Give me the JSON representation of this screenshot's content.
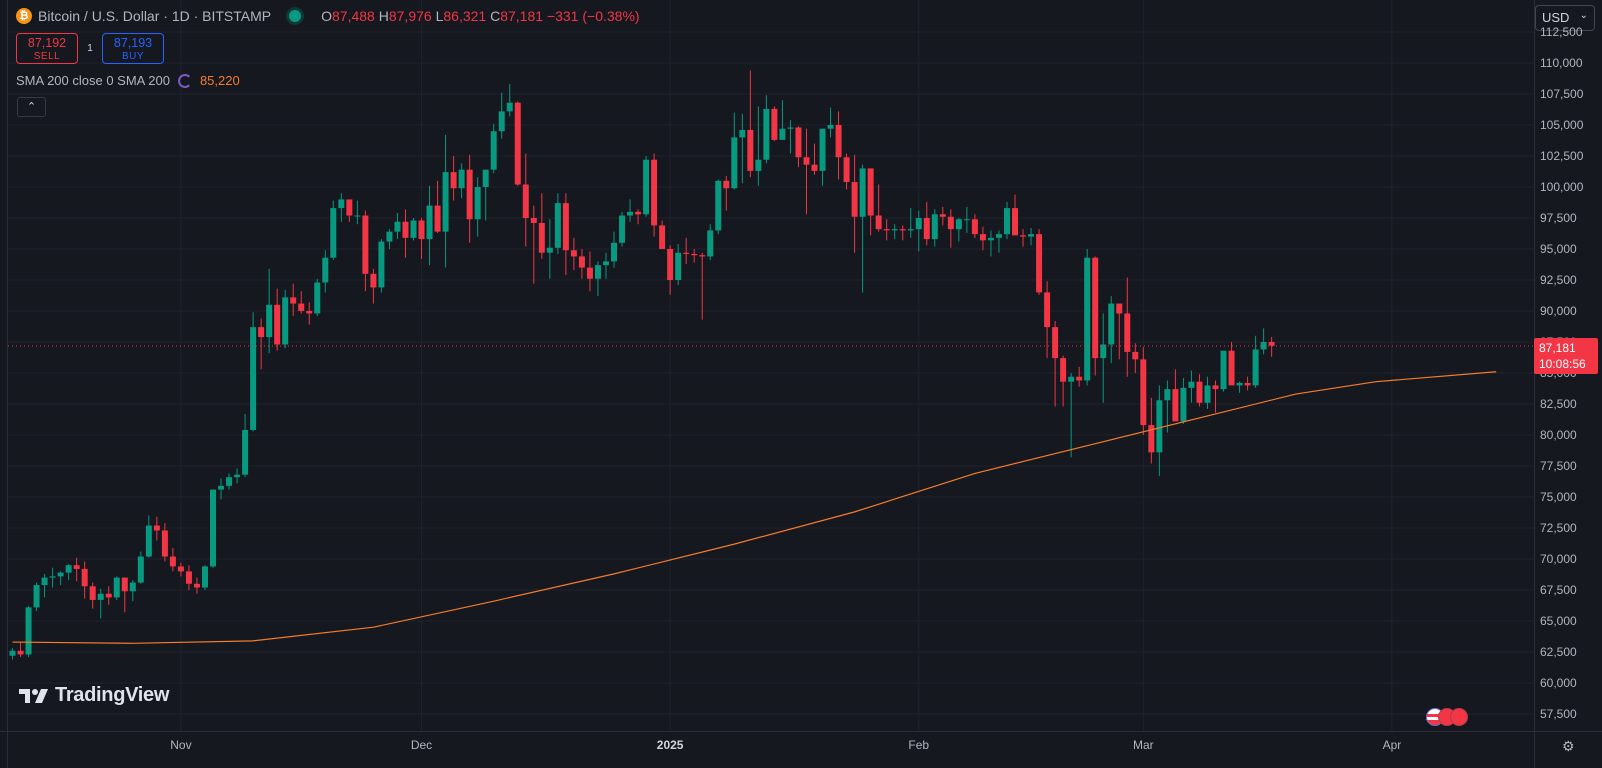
{
  "header": {
    "coin_symbol": "₿",
    "title": "Bitcoin / U.S. Dollar · 1D · BITSTAMP",
    "ohlc": {
      "o_label": "O",
      "o": "87,488",
      "h_label": "H",
      "h": "87,976",
      "l_label": "L",
      "l": "86,321",
      "c_label": "C",
      "c": "87,181",
      "change": "−331 (−0.38%)"
    }
  },
  "trade": {
    "sell_price": "87,192",
    "sell_label": "SELL",
    "spread": "1",
    "buy_price": "87,193",
    "buy_label": "BUY"
  },
  "indicator": {
    "label": "SMA 200 close 0 SMA 200",
    "value": "85,220"
  },
  "collapse_glyph": "⌃",
  "currency": {
    "label": "USD",
    "caret": "⌄"
  },
  "last_price": {
    "price": "87,181",
    "countdown": "10:08:56"
  },
  "brand": {
    "mark": "⁴⁷",
    "name": "TradingView"
  },
  "settings_glyph": "⚙",
  "colors": {
    "up": "#089981",
    "down": "#f23645",
    "sma": "#f57c2d",
    "grid": "#1e222d",
    "bg": "#15181e",
    "last_line": "#f23645"
  },
  "chart_data": {
    "type": "candlestick",
    "title": "Bitcoin / U.S. Dollar · 1D · BITSTAMP",
    "ylim": [
      57500,
      113000
    ],
    "y_ticks": [
      57500,
      60000,
      62500,
      65000,
      67500,
      70000,
      72500,
      75000,
      77500,
      80000,
      82500,
      85000,
      87500,
      90000,
      92500,
      95000,
      97500,
      100000,
      102500,
      105000,
      107500,
      110000,
      112500
    ],
    "y_tick_labels": [
      "57,500",
      "60,000",
      "62,500",
      "65,000",
      "67,500",
      "70,000",
      "72,500",
      "75,000",
      "77,500",
      "80,000",
      "82,500",
      "85,000",
      "87,500",
      "90,000",
      "92,500",
      "95,000",
      "97,500",
      "100,000",
      "102,500",
      "105,000",
      "107,500",
      "110,000",
      "112,500"
    ],
    "x_ticks": [
      {
        "label": "Nov",
        "day": "2024-11-01"
      },
      {
        "label": "Dec",
        "day": "2024-12-01"
      },
      {
        "label": "2025",
        "day": "2025-01-01",
        "bold": true
      },
      {
        "label": "Feb",
        "day": "2025-02-01"
      },
      {
        "label": "Mar",
        "day": "2025-03-01"
      },
      {
        "label": "Apr",
        "day": "2025-04-01"
      }
    ],
    "first_date": "2024-10-11",
    "candles": [
      [
        62200,
        62800,
        61900,
        62600
      ],
      [
        62600,
        63300,
        62100,
        62300
      ],
      [
        62300,
        66200,
        62100,
        66100
      ],
      [
        66100,
        68100,
        65800,
        67900
      ],
      [
        67900,
        68800,
        66900,
        68500
      ],
      [
        68500,
        69300,
        67700,
        68600
      ],
      [
        68600,
        69000,
        67900,
        68900
      ],
      [
        68900,
        69600,
        68300,
        69500
      ],
      [
        69500,
        70100,
        68200,
        69200
      ],
      [
        69200,
        69800,
        66800,
        67800
      ],
      [
        67800,
        68100,
        66000,
        66700
      ],
      [
        66700,
        67600,
        65200,
        67200
      ],
      [
        67200,
        67800,
        66300,
        66900
      ],
      [
        66900,
        68600,
        66700,
        68500
      ],
      [
        68500,
        68400,
        65700,
        67400
      ],
      [
        67400,
        68300,
        66600,
        68100
      ],
      [
        68100,
        70600,
        68000,
        70200
      ],
      [
        70200,
        73500,
        70100,
        72700
      ],
      [
        72700,
        73400,
        71500,
        72300
      ],
      [
        72300,
        72900,
        69800,
        70200
      ],
      [
        70200,
        70900,
        69000,
        69400
      ],
      [
        69400,
        69700,
        68600,
        69000
      ],
      [
        69000,
        69500,
        67500,
        68000
      ],
      [
        68000,
        68500,
        67200,
        67700
      ],
      [
        67700,
        69500,
        67500,
        69400
      ],
      [
        69400,
        75500,
        69300,
        75600
      ],
      [
        75600,
        76500,
        74800,
        75900
      ],
      [
        75900,
        76900,
        75600,
        76600
      ],
      [
        76600,
        77300,
        76100,
        76800
      ],
      [
        76800,
        81700,
        76600,
        80400
      ],
      [
        80400,
        89900,
        80300,
        88700
      ],
      [
        88700,
        89400,
        85300,
        87900
      ],
      [
        87900,
        93400,
        86600,
        90500
      ],
      [
        90500,
        91800,
        86800,
        87300
      ],
      [
        87300,
        91700,
        87000,
        91100
      ],
      [
        91100,
        92200,
        89600,
        90600
      ],
      [
        90600,
        91600,
        89800,
        90000
      ],
      [
        90000,
        90700,
        88900,
        89800
      ],
      [
        89800,
        92600,
        89600,
        92300
      ],
      [
        92300,
        94900,
        91500,
        94300
      ],
      [
        94300,
        98900,
        94100,
        98300
      ],
      [
        98300,
        99500,
        97200,
        99000
      ],
      [
        99000,
        99000,
        97200,
        97700
      ],
      [
        97700,
        98900,
        97000,
        97700
      ],
      [
        97700,
        98100,
        91600,
        93000
      ],
      [
        93000,
        93400,
        90600,
        91900
      ],
      [
        91900,
        95800,
        91500,
        95600
      ],
      [
        95600,
        96600,
        95000,
        96400
      ],
      [
        96400,
        97900,
        95800,
        97200
      ],
      [
        97200,
        98200,
        94300,
        95900
      ],
      [
        95900,
        97500,
        95700,
        97300
      ],
      [
        97300,
        97500,
        94200,
        95800
      ],
      [
        95800,
        100100,
        93700,
        98500
      ],
      [
        98500,
        100500,
        96300,
        96400
      ],
      [
        96400,
        104200,
        93500,
        101200
      ],
      [
        101200,
        102500,
        98900,
        99900
      ],
      [
        99900,
        101900,
        99100,
        101400
      ],
      [
        101400,
        102600,
        95500,
        97400
      ],
      [
        97400,
        100800,
        96000,
        100000
      ],
      [
        100000,
        101100,
        97300,
        101400
      ],
      [
        101400,
        105100,
        101100,
        104500
      ],
      [
        104500,
        107600,
        103900,
        106100
      ],
      [
        106100,
        108300,
        105700,
        106800
      ],
      [
        106800,
        106900,
        100100,
        100200
      ],
      [
        100200,
        102700,
        95200,
        97500
      ],
      [
        97500,
        98500,
        92200,
        97100
      ],
      [
        97100,
        99500,
        94200,
        94700
      ],
      [
        94700,
        97400,
        92600,
        95100
      ],
      [
        95100,
        99500,
        94600,
        98700
      ],
      [
        98700,
        99500,
        92900,
        94900
      ],
      [
        94900,
        95900,
        93300,
        94400
      ],
      [
        94400,
        95000,
        92600,
        93500
      ],
      [
        93500,
        94800,
        91600,
        92600
      ],
      [
        92600,
        94000,
        91200,
        93700
      ],
      [
        93700,
        94700,
        92600,
        94000
      ],
      [
        94000,
        96400,
        93500,
        95500
      ],
      [
        95500,
        98000,
        95200,
        97700
      ],
      [
        97700,
        99000,
        97200,
        98000
      ],
      [
        98000,
        98200,
        97000,
        97800
      ],
      [
        97800,
        102500,
        97600,
        102200
      ],
      [
        102200,
        102700,
        96000,
        96900
      ],
      [
        96900,
        97300,
        95200,
        95000
      ],
      [
        95000,
        95300,
        91300,
        92500
      ],
      [
        92500,
        95400,
        92100,
        94700
      ],
      [
        94700,
        95900,
        93800,
        94600
      ],
      [
        94600,
        95000,
        93900,
        94500
      ],
      [
        94500,
        94700,
        89300,
        94400
      ],
      [
        94400,
        97000,
        94100,
        96500
      ],
      [
        96500,
        100600,
        96200,
        100500
      ],
      [
        100500,
        100900,
        98100,
        99900
      ],
      [
        99900,
        106000,
        99800,
        104000
      ],
      [
        104000,
        105900,
        100300,
        104600
      ],
      [
        104600,
        109400,
        100800,
        101300
      ],
      [
        101300,
        106500,
        100100,
        102200
      ],
      [
        102200,
        107400,
        101900,
        106300
      ],
      [
        106300,
        106500,
        103700,
        103800
      ],
      [
        103800,
        107000,
        103800,
        104700
      ],
      [
        104700,
        105400,
        102700,
        104800
      ],
      [
        104800,
        104900,
        101600,
        102400
      ],
      [
        102400,
        104700,
        97800,
        101800
      ],
      [
        101800,
        103500,
        101000,
        101300
      ],
      [
        101300,
        103400,
        100100,
        104700
      ],
      [
        104700,
        106400,
        104000,
        105000
      ],
      [
        105000,
        106100,
        100600,
        102400
      ],
      [
        102400,
        102700,
        99800,
        100400
      ],
      [
        100400,
        102600,
        94700,
        97600
      ],
      [
        97600,
        101800,
        91500,
        101500
      ],
      [
        101500,
        101500,
        96100,
        97700
      ],
      [
        97700,
        100200,
        96400,
        96600
      ],
      [
        96600,
        97400,
        95700,
        96500
      ],
      [
        96500,
        97000,
        95800,
        96600
      ],
      [
        96600,
        96900,
        95700,
        96500
      ],
      [
        96500,
        98300,
        95900,
        96600
      ],
      [
        96600,
        98100,
        94800,
        97500
      ],
      [
        97500,
        98800,
        95300,
        95800
      ],
      [
        95800,
        98200,
        95200,
        97800
      ],
      [
        97800,
        98400,
        96900,
        97600
      ],
      [
        97600,
        98200,
        95100,
        96600
      ],
      [
        96600,
        97500,
        95600,
        97400
      ],
      [
        97400,
        98400,
        96300,
        97400
      ],
      [
        97400,
        97800,
        95900,
        96200
      ],
      [
        96200,
        96800,
        94900,
        95700
      ],
      [
        95700,
        96500,
        94400,
        95900
      ],
      [
        95900,
        96500,
        94700,
        96200
      ],
      [
        96200,
        98800,
        95800,
        98300
      ],
      [
        98300,
        99400,
        96200,
        96100
      ],
      [
        96100,
        96600,
        95200,
        96000
      ],
      [
        96000,
        96700,
        95300,
        96200
      ],
      [
        96200,
        96600,
        91300,
        91500
      ],
      [
        91500,
        92400,
        86200,
        88700
      ],
      [
        88700,
        89200,
        82300,
        86200
      ],
      [
        86200,
        86400,
        82300,
        84300
      ],
      [
        84300,
        85000,
        78200,
        84700
      ],
      [
        84700,
        85500,
        83900,
        84400
      ],
      [
        84400,
        95000,
        84000,
        94300
      ],
      [
        94300,
        94400,
        84800,
        86200
      ],
      [
        86200,
        89800,
        82600,
        87300
      ],
      [
        87300,
        91200,
        85800,
        90600
      ],
      [
        90600,
        90500,
        86100,
        89800
      ],
      [
        89800,
        92700,
        84700,
        86700
      ],
      [
        86700,
        87400,
        85000,
        86100
      ],
      [
        86100,
        87100,
        80000,
        80800
      ],
      [
        80800,
        83000,
        77700,
        78600
      ],
      [
        78600,
        84000,
        76700,
        82800
      ],
      [
        82800,
        84400,
        80200,
        83700
      ],
      [
        83700,
        85300,
        81200,
        81100
      ],
      [
        81100,
        84600,
        80900,
        83800
      ],
      [
        83800,
        85200,
        82600,
        84300
      ],
      [
        84300,
        84900,
        82300,
        82600
      ],
      [
        82600,
        84700,
        82100,
        84000
      ],
      [
        84000,
        84400,
        81800,
        83700
      ],
      [
        83700,
        86700,
        83500,
        86800
      ],
      [
        86800,
        87500,
        85900,
        84000
      ],
      [
        84000,
        84300,
        83400,
        84200
      ],
      [
        84200,
        84700,
        83600,
        84000
      ],
      [
        84000,
        88000,
        83800,
        86900
      ],
      [
        86900,
        88600,
        86500,
        87500
      ],
      [
        87500,
        87900,
        86300,
        87200
      ]
    ],
    "sma200": [
      [
        0,
        63300
      ],
      [
        15,
        63200
      ],
      [
        30,
        63400
      ],
      [
        45,
        64500
      ],
      [
        60,
        66600
      ],
      [
        75,
        68800
      ],
      [
        90,
        71200
      ],
      [
        105,
        73800
      ],
      [
        120,
        76900
      ],
      [
        135,
        79300
      ],
      [
        150,
        81700
      ],
      [
        160,
        83300
      ],
      [
        170,
        84300
      ],
      [
        185,
        85100
      ]
    ],
    "last_price": 87181
  }
}
